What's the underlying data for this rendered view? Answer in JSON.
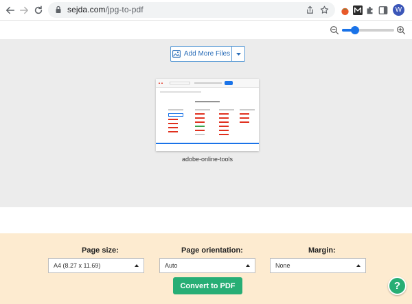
{
  "browser": {
    "url_host": "sejda.com",
    "url_path": "/jpg-to-pdf",
    "avatar_initial": "W",
    "icons": {
      "back": "arrow-left-icon",
      "forward": "arrow-right-icon",
      "reload": "reload-icon",
      "lock": "lock-icon",
      "share": "share-icon",
      "bookmark": "star-icon",
      "extensions": [
        "tomato-extension-icon",
        "m-extension-icon",
        "puzzle-icon",
        "side-panel-icon"
      ]
    }
  },
  "zoom": {
    "level": 0.2
  },
  "toolbar": {
    "add_more_files": "Add More Files"
  },
  "files": [
    {
      "name": "adobe-online-tools"
    }
  ],
  "options": {
    "page_size_label": "Page size:",
    "page_size_value": "A4 (8.27 x 11.69)",
    "orientation_label": "Page orientation:",
    "orientation_value": "Auto",
    "margin_label": "Margin:",
    "margin_value": "None",
    "convert_label": "Convert to PDF"
  },
  "help": {
    "label": "?"
  },
  "colors": {
    "accent": "#27ae75",
    "link_blue": "#2a6db8",
    "options_bg": "#fdebd0",
    "canvas_bg": "#ececec"
  }
}
